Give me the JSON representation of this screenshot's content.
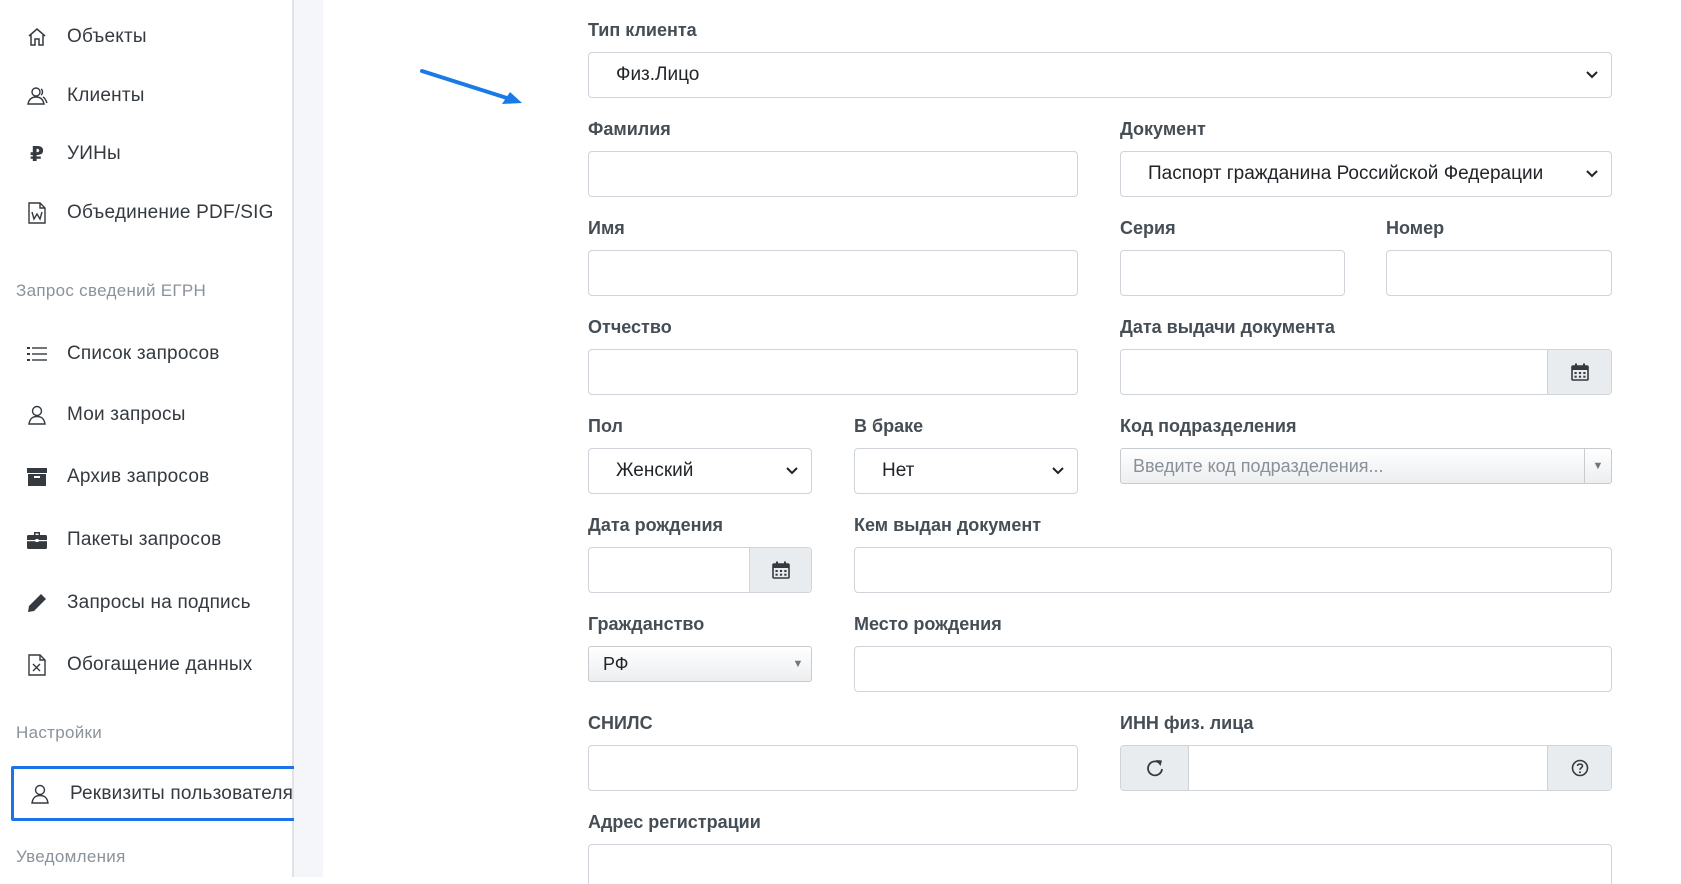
{
  "sidebar": {
    "items": [
      {
        "label": "Объекты",
        "icon": "home-icon"
      },
      {
        "label": "Клиенты",
        "icon": "users-icon"
      },
      {
        "label": "УИНы",
        "icon": "ruble-icon"
      },
      {
        "label": "Объединение PDF/SIG",
        "icon": "file-word-icon"
      }
    ],
    "section_egrn": "Запрос сведений ЕГРН",
    "egrn_items": [
      {
        "label": "Список запросов",
        "icon": "list-icon"
      },
      {
        "label": "Мои запросы",
        "icon": "user-icon"
      },
      {
        "label": "Архив запросов",
        "icon": "archive-icon"
      },
      {
        "label": "Пакеты запросов",
        "icon": "briefcase-icon"
      },
      {
        "label": "Запросы на подпись",
        "icon": "pencil-icon"
      },
      {
        "label": "Обогащение данных",
        "icon": "file-excel-icon"
      }
    ],
    "section_settings": "Настройки",
    "settings_items": [
      {
        "label": "Реквизиты пользователя",
        "icon": "user-icon"
      }
    ],
    "section_notifications": "Уведомления"
  },
  "form": {
    "client_type": {
      "label": "Тип клиента",
      "value": "Физ.Лицо"
    },
    "last_name": {
      "label": "Фамилия",
      "value": ""
    },
    "document": {
      "label": "Документ",
      "value": "Паспорт гражданина Российской Федерации"
    },
    "first_name": {
      "label": "Имя",
      "value": ""
    },
    "series": {
      "label": "Серия",
      "value": ""
    },
    "number": {
      "label": "Номер",
      "value": ""
    },
    "patronymic": {
      "label": "Отчество",
      "value": ""
    },
    "issue_date": {
      "label": "Дата выдачи документа",
      "value": ""
    },
    "gender": {
      "label": "Пол",
      "value": "Женский"
    },
    "married": {
      "label": "В браке",
      "value": "Нет"
    },
    "dept_code": {
      "label": "Код подразделения",
      "placeholder": "Введите код подразделения..."
    },
    "birth_date": {
      "label": "Дата рождения",
      "value": ""
    },
    "issued_by": {
      "label": "Кем выдан документ",
      "value": ""
    },
    "citizenship": {
      "label": "Гражданство",
      "value": "РФ"
    },
    "birth_place": {
      "label": "Место рождения",
      "value": ""
    },
    "snils": {
      "label": "СНИЛС",
      "value": ""
    },
    "inn": {
      "label": "ИНН физ. лица",
      "value": ""
    },
    "reg_address": {
      "label": "Адрес регистрации",
      "value": ""
    }
  },
  "colors": {
    "accent": "#1a73e8",
    "annotation_arrow": "#1a7ae6"
  }
}
